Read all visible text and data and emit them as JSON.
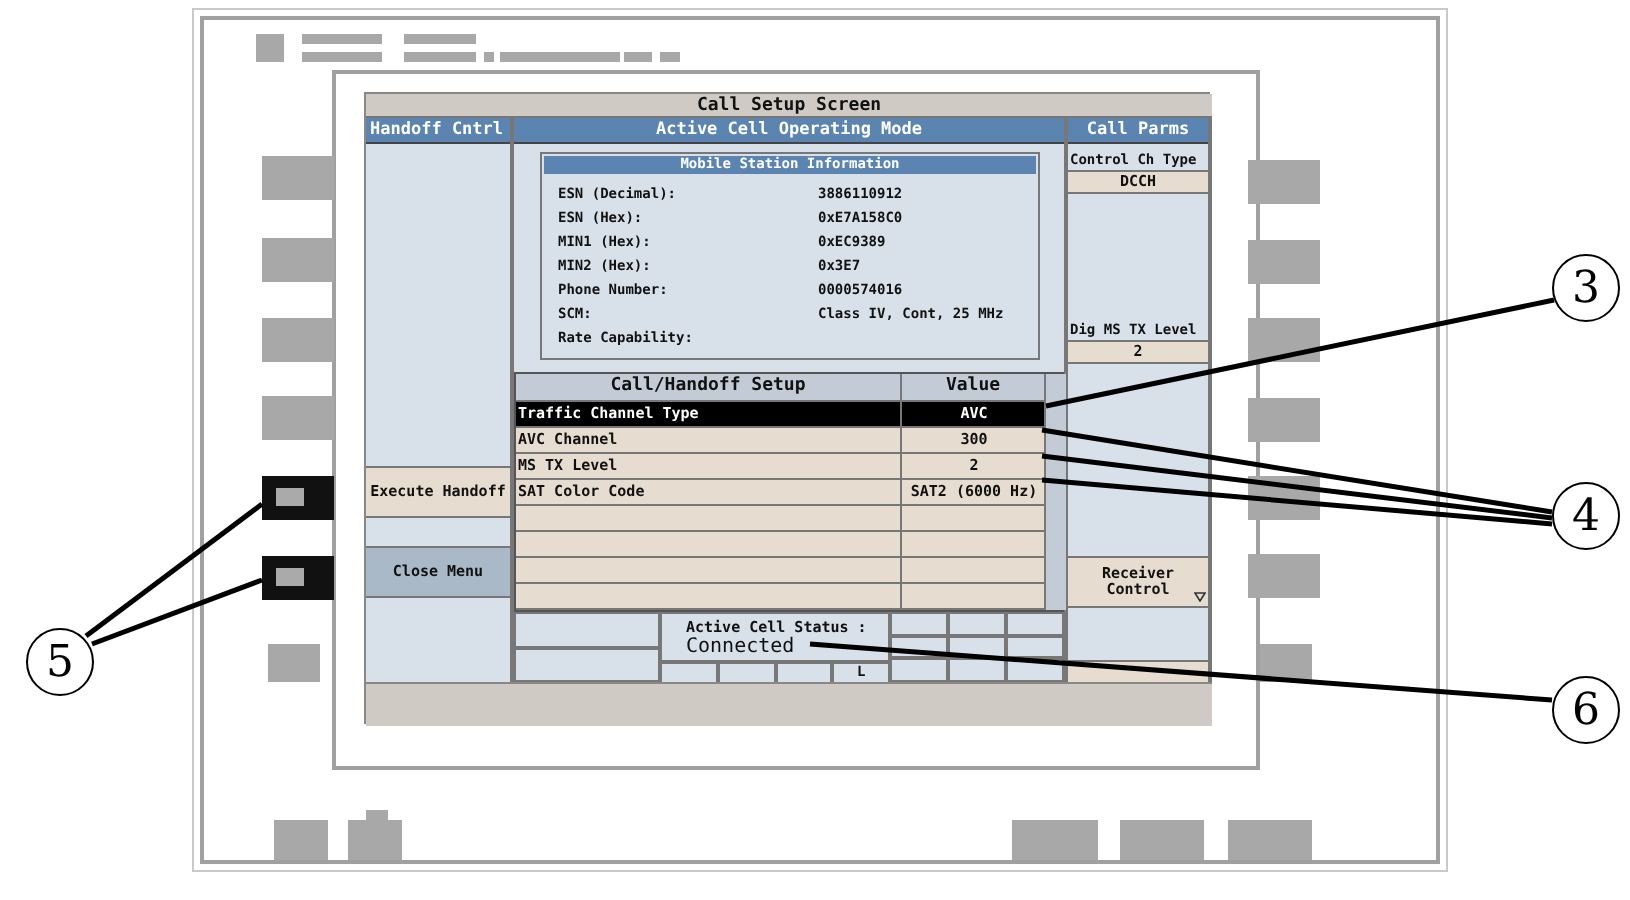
{
  "screen": {
    "title": "Call Setup Screen",
    "left_column": {
      "header": "Handoff Cntrl",
      "keys": [
        {
          "label": "Execute Handoff",
          "kind": "action"
        },
        {
          "label": "Close Menu",
          "kind": "menu"
        }
      ]
    },
    "middle_column": {
      "header": "Active Cell Operating Mode",
      "ms_info": {
        "title": "Mobile Station Information",
        "rows": [
          {
            "label": "ESN (Decimal):",
            "value": "3886110912"
          },
          {
            "label": "ESN (Hex):",
            "value": "0xE7A158C0"
          },
          {
            "label": "MIN1 (Hex):",
            "value": "0xEC9389"
          },
          {
            "label": "MIN2 (Hex):",
            "value": "0x3E7"
          },
          {
            "label": "Phone Number:",
            "value": "0000574016"
          },
          {
            "label": "SCM:",
            "value": "Class IV, Cont, 25 MHz"
          },
          {
            "label": "Rate Capability:"
          }
        ]
      },
      "table": {
        "columns": [
          "Call/Handoff Setup",
          "Value"
        ],
        "rows": [
          {
            "name": "Traffic Channel Type",
            "value": "AVC",
            "selected": true
          },
          {
            "name": "AVC Channel",
            "value": "300",
            "selected": false
          },
          {
            "name": "MS TX Level",
            "value": "2",
            "selected": false
          },
          {
            "name": "SAT Color Code",
            "value": "SAT2 (6000 Hz)",
            "selected": false
          }
        ]
      },
      "status": {
        "label": "Active Cell Status :",
        "value": "Connected",
        "indicator": "L"
      }
    },
    "right_column": {
      "header": "Call Parms",
      "items": [
        {
          "kind": "label",
          "text": "Control Ch Type"
        },
        {
          "kind": "value",
          "text": "DCCH"
        },
        {
          "kind": "gap"
        },
        {
          "kind": "label",
          "text": "Dig MS TX Level"
        },
        {
          "kind": "value",
          "text": "2"
        },
        {
          "kind": "gap"
        },
        {
          "kind": "action",
          "text": "Receiver Control"
        }
      ]
    }
  },
  "callouts": [
    {
      "label": "3"
    },
    {
      "label": "4"
    },
    {
      "label": "5"
    },
    {
      "label": "6"
    }
  ]
}
